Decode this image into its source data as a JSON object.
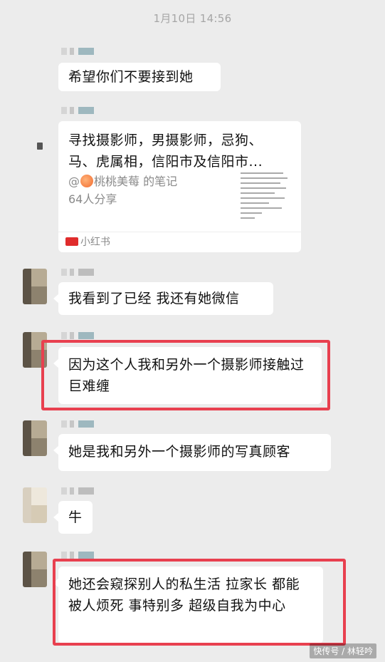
{
  "timestamp": "1月10日 14:56",
  "messages": [
    {
      "text": "希望你们不要接到她"
    },
    {
      "text": "我看到了已经 我还有她微信"
    },
    {
      "text": "因为这个人我和另外一个摄影师接触过 巨难缠"
    },
    {
      "text": "她是我和另外一个摄影师的写真顾客"
    },
    {
      "text": "牛"
    },
    {
      "text": "她还会窥探别人的私生活 拉家长 都能被人烦死 事特别多 超级自我为中心"
    }
  ],
  "shared_card": {
    "title": "寻找摄影师，男摄影师，忌狗、马、虎属相，信阳市及信阳市...",
    "author_prefix": "@",
    "author": "桃桃美莓",
    "author_suffix": " 的笔记",
    "shares": "64人分享",
    "source": "小红书",
    "thumbnail_icon": "document-thumbnail-icon",
    "peach_icon": "peach-emoji-icon"
  },
  "highlight_color": "#e8404f",
  "watermark": "快传号 / 林轻吟"
}
